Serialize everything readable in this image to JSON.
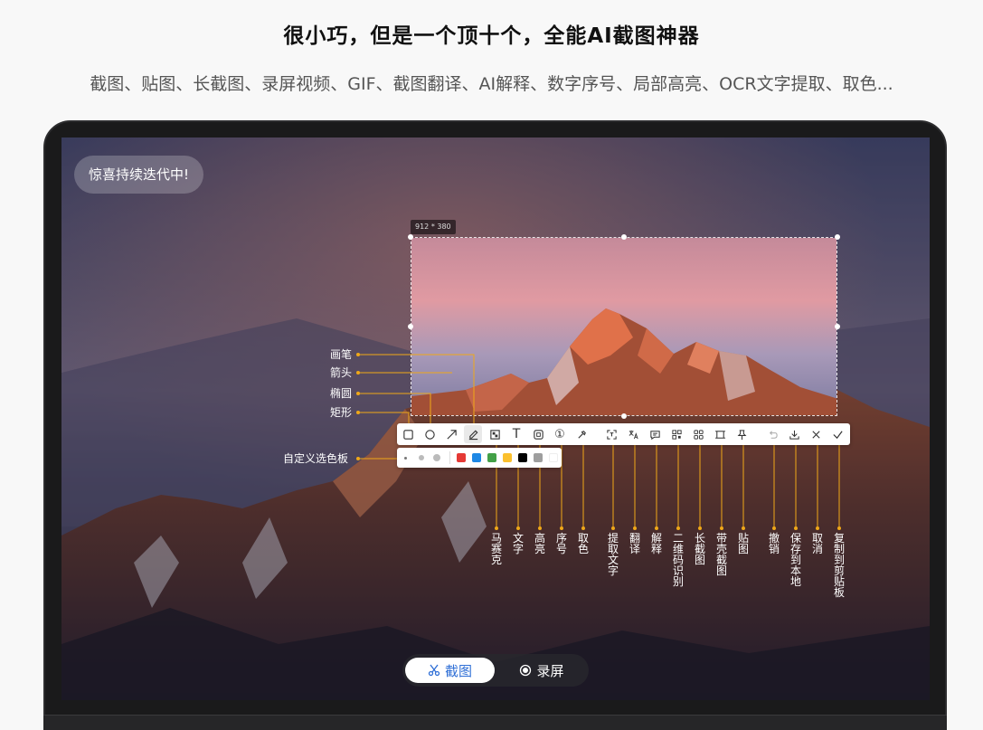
{
  "headline": "很小巧，但是一个顶十个，全能AI截图神器",
  "features": "截图、贴图、长截图、录屏视频、GIF、截图翻译、AI解释、数字序号、局部高亮、OCR文字提取、取色...",
  "badge": "惊喜持续迭代中!",
  "selection_size": "912 * 380",
  "callouts_left": {
    "pen": "画笔",
    "arrow": "箭头",
    "ellipse": "椭圆",
    "rect": "矩形",
    "palette": "自定义选色板"
  },
  "toolbar": {
    "tools": [
      "rectangle-tool",
      "ellipse-tool",
      "arrow-tool",
      "pen-tool",
      "mosaic-tool",
      "text-tool",
      "highlight-tool",
      "number-tool",
      "color-picker-tool",
      "ocr-tool",
      "translate-tool",
      "ai-explain-tool",
      "qr-code-tool",
      "long-screenshot-tool",
      "frame-screenshot-tool",
      "pin-tool",
      "undo-tool",
      "save-tool",
      "cancel-tool",
      "copy-tool"
    ],
    "text_glyph": "T",
    "number_glyph": "①"
  },
  "palette_colors": [
    "#e53935",
    "#1e88e5",
    "#43a047",
    "#fbc02d",
    "#000000",
    "#9e9e9e",
    "#ffffff"
  ],
  "tool_labels": {
    "mosaic": "马赛克",
    "text": "文字",
    "highlight": "高亮",
    "number": "序号",
    "pick_color": "取色",
    "ocr": "提取文字",
    "translate": "翻译",
    "explain": "解释",
    "qr": "二维码识别",
    "long_shot": "长截图",
    "frame_shot": "带壳截图",
    "pin": "贴图",
    "undo": "撤销",
    "save": "保存到本地",
    "cancel": "取消",
    "copy": "复制到剪贴板"
  },
  "modes": {
    "screenshot": "截图",
    "record": "录屏"
  },
  "accent_color": "#2f6fd6",
  "callout_color": "#f0a818"
}
